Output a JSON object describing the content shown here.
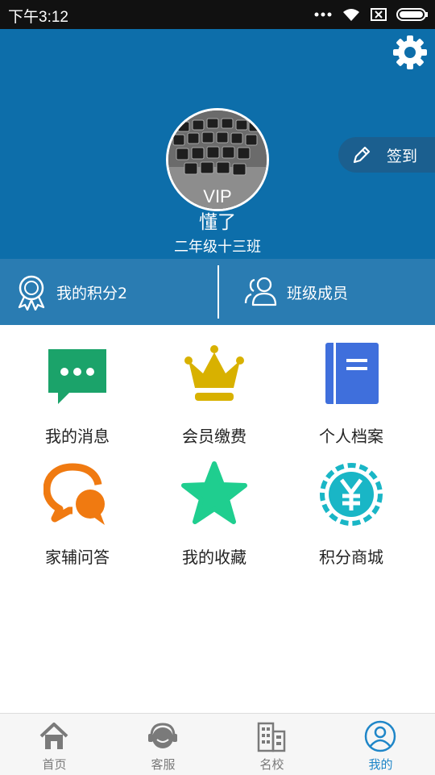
{
  "status_bar": {
    "time": "下午3:12"
  },
  "profile": {
    "vip_label": "VIP",
    "name": "懂了",
    "class_name": "二年级十三班",
    "checkin_label": "签到"
  },
  "stats": {
    "points_label": "我的积分2",
    "members_label": "班级成员"
  },
  "menu": [
    {
      "label": "我的消息",
      "icon": "message-icon",
      "color": "#1ba36a"
    },
    {
      "label": "会员缴费",
      "icon": "crown-icon",
      "color": "#d8b100"
    },
    {
      "label": "个人档案",
      "icon": "notebook-icon",
      "color": "#3f6fdc"
    },
    {
      "label": "家辅问答",
      "icon": "chat-bubbles-icon",
      "color": "#f07a11"
    },
    {
      "label": "我的收藏",
      "icon": "star-icon",
      "color": "#1fce8f"
    },
    {
      "label": "积分商城",
      "icon": "yen-coin-icon",
      "color": "#19b6c6"
    }
  ],
  "tabbar": {
    "tabs": [
      {
        "label": "首页",
        "icon": "home-icon"
      },
      {
        "label": "客服",
        "icon": "headset-icon"
      },
      {
        "label": "名校",
        "icon": "building-icon"
      },
      {
        "label": "我的",
        "icon": "user-icon"
      }
    ],
    "active_color": "#1f86c8",
    "inactive_color": "#7a7a7a"
  },
  "colors": {
    "header": "#0d6eaa",
    "strip": "#2a7cb2"
  }
}
